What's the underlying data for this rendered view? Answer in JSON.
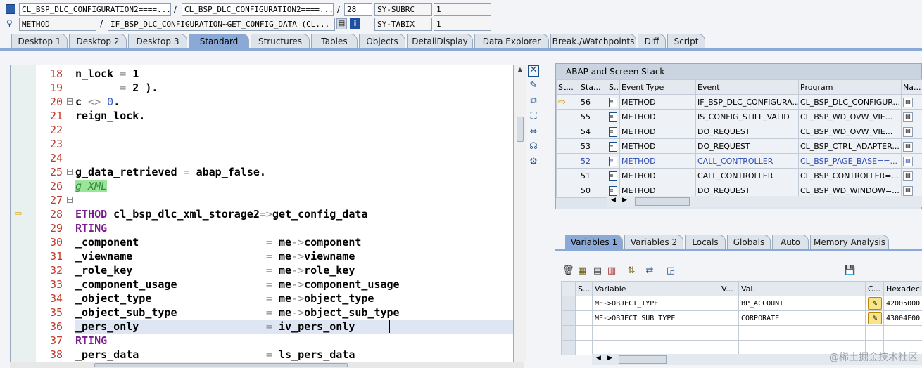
{
  "header": {
    "row1": {
      "field1": "CL_BSP_DLC_CONFIGURATION2====...",
      "sep1": "/",
      "field2": "CL_BSP_DLC_CONFIGURATION2====...",
      "sep2": "/",
      "line": "28",
      "sysfield": "SY-SUBRC",
      "sysval": "1"
    },
    "row2": {
      "type": "METHOD",
      "sep1": "/",
      "event": "IF_BSP_DLC_CONFIGURATION~GET_CONFIG_DATA (CL...",
      "sysfield": "SY-TABIX",
      "sysval": "1"
    }
  },
  "tabs": [
    "Desktop 1",
    "Desktop 2",
    "Desktop 3",
    "Standard",
    "Structures",
    "Tables",
    "Objects",
    "DetailDisplay",
    "Data Explorer",
    "Break./Watchpoints",
    "Diff",
    "Script"
  ],
  "active_tab": "Standard",
  "editor": {
    "lines": [
      {
        "n": "18",
        "code": "n_lock = 1"
      },
      {
        "n": "19",
        "code": "       = 2 )."
      },
      {
        "n": "20",
        "code": "c <> 0."
      },
      {
        "n": "21",
        "code": "reign_lock."
      },
      {
        "n": "22",
        "code": ""
      },
      {
        "n": "23",
        "code": ""
      },
      {
        "n": "24",
        "code": ""
      },
      {
        "n": "25",
        "code": "g_data_retrieved = abap_false."
      },
      {
        "n": "26",
        "code": "g XML"
      },
      {
        "n": "27",
        "code": ""
      },
      {
        "n": "28",
        "code": "ETHOD cl_bsp_dlc_xml_storage2=>get_config_data"
      },
      {
        "n": "29",
        "code": "RTING"
      },
      {
        "n": "30",
        "code": "_component                    = me->component"
      },
      {
        "n": "31",
        "code": "_viewname                     = me->viewname"
      },
      {
        "n": "32",
        "code": "_role_key                     = me->role_key"
      },
      {
        "n": "33",
        "code": "_component_usage              = me->component_usage"
      },
      {
        "n": "34",
        "code": "_object_type                  = me->object_type"
      },
      {
        "n": "35",
        "code": "_object_sub_type              = me->object_sub_type"
      },
      {
        "n": "36",
        "code": "_pers_only                    = iv_pers_only"
      },
      {
        "n": "37",
        "code": "RTING"
      },
      {
        "n": "38",
        "code": "_pers_data                    = ls_pers_data"
      }
    ]
  },
  "stack": {
    "title": "ABAP and Screen Stack",
    "columns": [
      "St...",
      "Sta...",
      "S...",
      "Event Type",
      "Event",
      "Program",
      "Na..."
    ],
    "rows": [
      {
        "level": "56",
        "type": "METHOD",
        "event": "IF_BSP_DLC_CONFIGURA...",
        "program": "CL_BSP_DLC_CONFIGUR...",
        "current": true
      },
      {
        "level": "55",
        "type": "METHOD",
        "event": "IS_CONFIG_STILL_VALID",
        "program": "CL_BSP_WD_OVW_VIE...",
        "current": false
      },
      {
        "level": "54",
        "type": "METHOD",
        "event": "DO_REQUEST",
        "program": "CL_BSP_WD_OVW_VIE...",
        "current": false
      },
      {
        "level": "53",
        "type": "METHOD",
        "event": "DO_REQUEST",
        "program": "CL_BSP_CTRL_ADAPTER...",
        "current": false
      },
      {
        "level": "52",
        "type": "METHOD",
        "event": "CALL_CONTROLLER",
        "program": "CL_BSP_PAGE_BASE==...",
        "current": false
      },
      {
        "level": "51",
        "type": "METHOD",
        "event": "CALL_CONTROLLER",
        "program": "CL_BSP_CONTROLLER=...",
        "current": false
      },
      {
        "level": "50",
        "type": "METHOD",
        "event": "DO_REQUEST",
        "program": "CL_BSP_WD_WINDOW=...",
        "current": false
      }
    ]
  },
  "var_tabs": [
    "Variables 1",
    "Variables 2",
    "Locals",
    "Globals",
    "Auto",
    "Memory Analysis"
  ],
  "var_active": "Variables 1",
  "variables": {
    "columns": [
      "S...",
      "Variable",
      "V...",
      "Val.",
      "C...",
      "Hexadecin"
    ],
    "rows": [
      {
        "name": "ME->OBJECT_TYPE",
        "value": "BP_ACCOUNT",
        "hex": "42005000"
      },
      {
        "name": "ME->OBJECT_SUB_TYPE",
        "value": "CORPORATE",
        "hex": "43004F00"
      }
    ]
  },
  "watermark": "@稀土掘金技术社区"
}
